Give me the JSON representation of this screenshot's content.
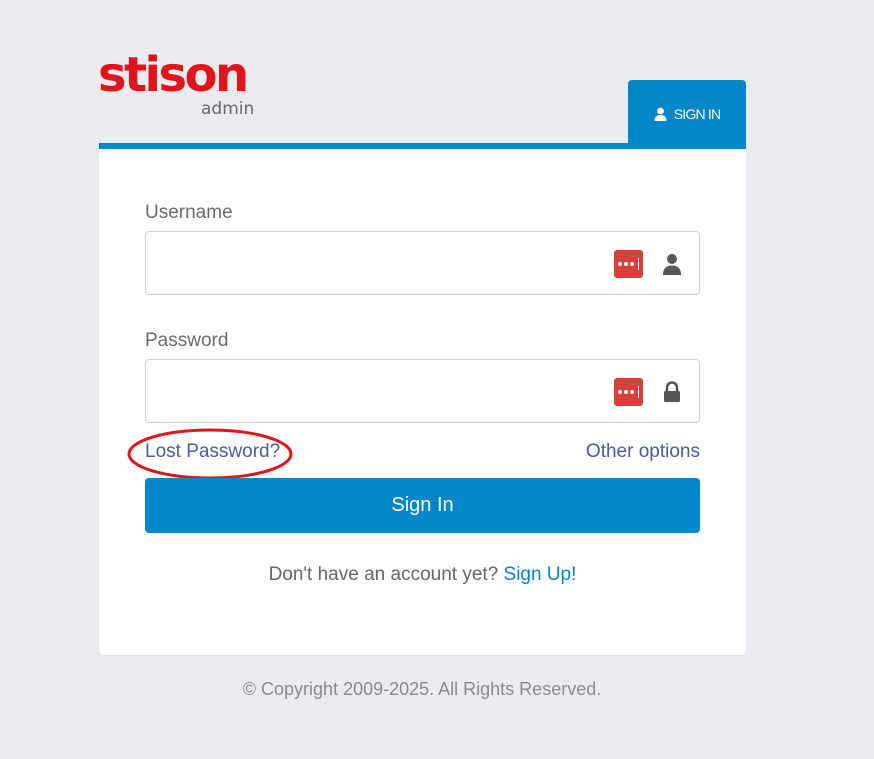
{
  "logo": {
    "brand": "stison",
    "sub": "admin"
  },
  "tab": {
    "label": "SIGN IN",
    "icon": "user-icon"
  },
  "form": {
    "username_label": "Username",
    "username_value": "",
    "username_icon": "user-icon",
    "password_label": "Password",
    "password_value": "",
    "password_icon": "lock-icon",
    "password_manager_icon": "password-manager-icon",
    "lost_password": "Lost Password?",
    "other_options": "Other options",
    "sign_in_button": "Sign In",
    "signup_prompt": "Don't have an account yet?",
    "signup_link": "Sign Up!"
  },
  "footer": {
    "copyright": "© Copyright 2009-2025. All Rights Reserved."
  },
  "colors": {
    "brand_red": "#e0141a",
    "primary_blue": "#0287cb",
    "background": "#ebecf0",
    "password_manager_red": "#d9403c",
    "annotation_red": "#e0141a"
  }
}
